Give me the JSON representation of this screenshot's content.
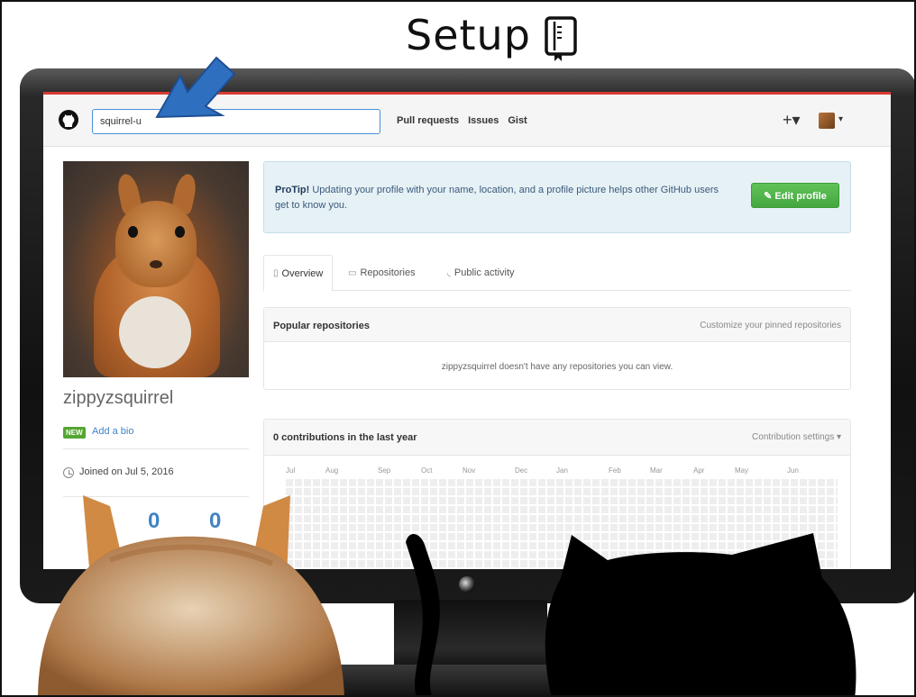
{
  "slide": {
    "title": "Setup"
  },
  "icons": {
    "book": "book-icon",
    "octocat": "github-octocat-icon",
    "clock": "clock-icon",
    "overview": "book-icon",
    "repositories": "repo-icon",
    "activity": "rss-icon"
  },
  "header": {
    "search_value": "squirrel-u",
    "nav": [
      "Pull requests",
      "Issues",
      "Gist"
    ],
    "plus": "+▾",
    "caret": "▾"
  },
  "profile": {
    "username": "zippyzsquirrel",
    "new_badge": "NEW",
    "add_bio": "Add a bio",
    "joined": "Joined on Jul 5, 2016",
    "stat_a": "0",
    "stat_b": "0"
  },
  "protip": {
    "lead": "ProTip!",
    "text": " Updating your profile with your name, location, and a profile picture helps other GitHub users get to know you.",
    "edit_button": "✎ Edit profile"
  },
  "tabs": [
    "Overview",
    "Repositories",
    "Public activity"
  ],
  "popular": {
    "title": "Popular repositories",
    "customize": "Customize your pinned repositories",
    "empty": "zippyzsquirrel doesn't have any repositories you can view."
  },
  "contributions": {
    "title": "0 contributions in the last year",
    "settings": "Contribution settings ▾",
    "months": [
      "Jul",
      "Aug",
      "Sep",
      "Oct",
      "Nov",
      "Dec",
      "Jan",
      "Feb",
      "Mar",
      "Apr",
      "May",
      "Jun"
    ]
  },
  "colors": {
    "accent_red": "#d63b32",
    "link_blue": "#4183c4",
    "green_button": "#55a532",
    "arrow_blue": "#2f6fbf"
  }
}
